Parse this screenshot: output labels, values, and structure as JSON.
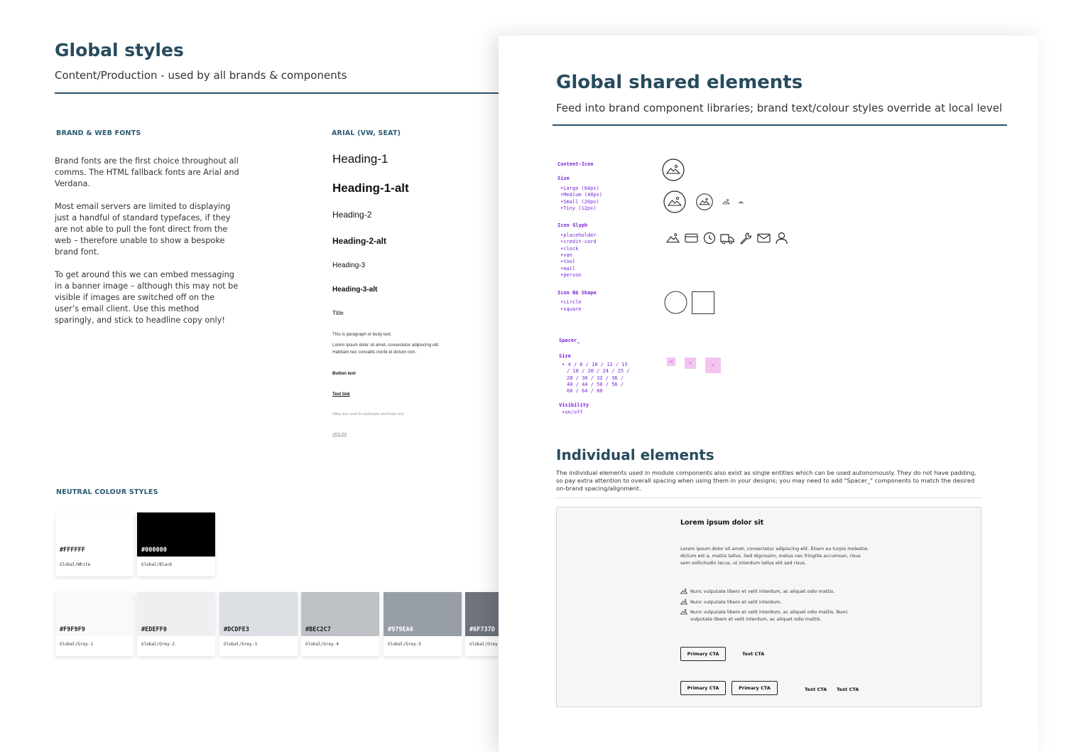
{
  "global_styles": {
    "title": "Global styles",
    "subtitle": "Content/Production - used by all brands & components",
    "brand_fonts_label": "BRAND & WEB FONTS",
    "brand_fonts_paragraphs": [
      "Brand fonts are the first choice throughout all comms. The HTML fallback fonts are Arial and Verdana.",
      "Most email servers are limited to displaying just a handful of standard typefaces, if they are not able to pull the font direct from the web – therefore unable to show a bespoke brand font.",
      "To get around this we can embed messaging in a banner image – although this may not be visible if images are switched off on the user’s email client. Use this method sparingly, and stick to headline copy only!"
    ],
    "arial_label": "ARIAL (VW, SEAT)",
    "typography": {
      "h1": "Heading-1",
      "h1_alt": "Heading-1-alt",
      "h2": "Heading-2",
      "h2_alt": "Heading-2-alt",
      "h3": "Heading-3",
      "h3_alt": "Heading-3-alt",
      "title": "Title",
      "para_1": "This is paragraph or body text.",
      "para_2": "Lorem ipsum dolor sit amet, consectetur adipiscing elit.",
      "para_3": "Habitant nec convallis morbi et dictum non.",
      "button_text": "Button text",
      "text_link": "Text link",
      "utility_text": "Utility text: used for preheader and footer text.",
      "utility_link": "utility link"
    },
    "neutral_label": "NEUTRAL COLOUR STYLES",
    "swatches": [
      {
        "hex": "#FFFFFF",
        "name": "Global/White",
        "color": "#FFFFFF",
        "text_color": "#222222"
      },
      {
        "hex": "#000000",
        "name": "Global/Black",
        "color": "#000000",
        "text_color": "#FFFFFF"
      },
      {
        "hex": "#F9F9F9",
        "name": "Global/Grey-1",
        "color": "#F9F9F9",
        "text_color": "#222222"
      },
      {
        "hex": "#EDEFF0",
        "name": "Global/Grey-2",
        "color": "#EDEFF0",
        "text_color": "#222222"
      },
      {
        "hex": "#DCDFE3",
        "name": "Global/Grey-3",
        "color": "#DCDFE3",
        "text_color": "#222222"
      },
      {
        "hex": "#BEC2C7",
        "name": "Global/Grey-4",
        "color": "#BEC2C7",
        "text_color": "#222222"
      },
      {
        "hex": "#979EA6",
        "name": "Global/Grey-5",
        "color": "#979EA6",
        "text_color": "#FFFFFF"
      },
      {
        "hex": "#6F737D",
        "name": "Global/Grey",
        "color": "#6F737D",
        "text_color": "#FFFFFF"
      }
    ]
  },
  "shared": {
    "title": "Global shared elements",
    "subtitle": "Feed into brand component libraries; brand text/colour styles override at local level",
    "content_icon": {
      "heading": "Content-Icon",
      "size_heading": "Size",
      "sizes": [
        "Large (64px)",
        "Medium (48px)",
        "Small (20px)",
        "Tiny (12px)"
      ],
      "glyph_heading": "Icon Glyph",
      "glyphs": [
        "placeholder",
        "credit-card",
        "clock",
        "van",
        "tool",
        "mail",
        "person"
      ],
      "bg_heading": "Icon BG Shape",
      "bg_shapes": [
        "circle",
        "square"
      ]
    },
    "spacer": {
      "heading": "Spacer_",
      "size_heading": "Size",
      "size_lines": [
        "4 / 8 / 10 / 12 / 15",
        "/ 18 / 20 / 24 / 25 /",
        "28 / 30 / 32 / 36 /",
        "40 / 44 / 50 / 56 /",
        "60 / 64 / 80"
      ],
      "visibility_heading": "Visibility",
      "visibility_values": [
        "on/off"
      ],
      "samples": [
        "24",
        "32",
        "44"
      ]
    },
    "individual": {
      "title": "Individual elements",
      "body": "The individual elements used in module components also exist as single entities which can be used autonomously. They do not have padding, so pay extra attention to overall spacing when using them in your designs; you may need to add \"Spacer_\" components to match the desired on-brand spacing/alignment.",
      "module_title": "Lorem ipsum dolor sit",
      "module_body": "Lorem ipsum dolor sit amet, consectetur adipiscing elit. Etiam eu turpis molestie, dictum est a, mattis tellus. Sed dignissim, metus nec fringilla accumsan, risus sem sollicitudin lacus, ut interdum tellus elit sed risus.",
      "list_items": [
        "Nunc vulputate libero et velit interdum, ac aliquet odio mattis.",
        "Nunc vulputate libero et velit interdum.",
        "Nunc vulputate libero et velit interdum, ac aliquet odio mattis. Nunc vulputate libero et velit interdum, ac aliquet odio mattis."
      ],
      "primary_cta": "Primary CTA",
      "text_cta": "Text CTA"
    }
  }
}
